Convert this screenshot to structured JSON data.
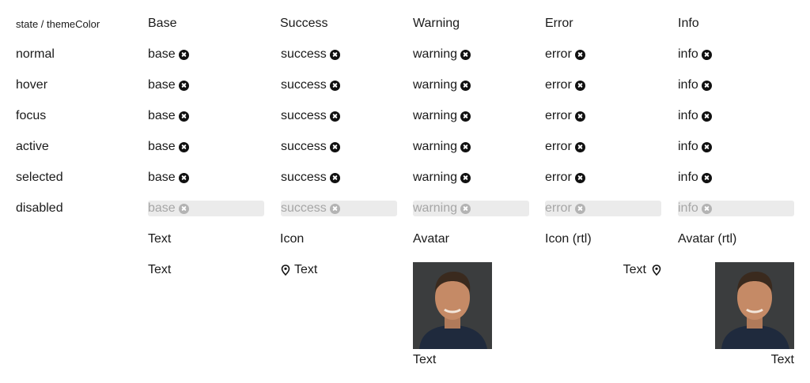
{
  "corner_label": "state / themeColor",
  "columns": [
    "Base",
    "Success",
    "Warning",
    "Error",
    "Info"
  ],
  "chip_labels": [
    "base",
    "success",
    "warning",
    "error",
    "info"
  ],
  "states": [
    "normal",
    "hover",
    "focus",
    "active",
    "selected",
    "disabled"
  ],
  "variants": {
    "headers": [
      "Text",
      "Icon",
      "Avatar",
      "Icon (rtl)",
      "Avatar (rtl)"
    ],
    "text_label": "Text",
    "icon_label": "Text",
    "avatar_label": "Text",
    "icon_rtl_label": "Text",
    "avatar_rtl_label": "Text"
  },
  "icons": {
    "remove": "close-circle-icon",
    "location": "map-pin-icon"
  },
  "colors": {
    "disabled_bg": "#ebebeb",
    "disabled_text": "#a6a6a6",
    "icon": "#111111"
  }
}
